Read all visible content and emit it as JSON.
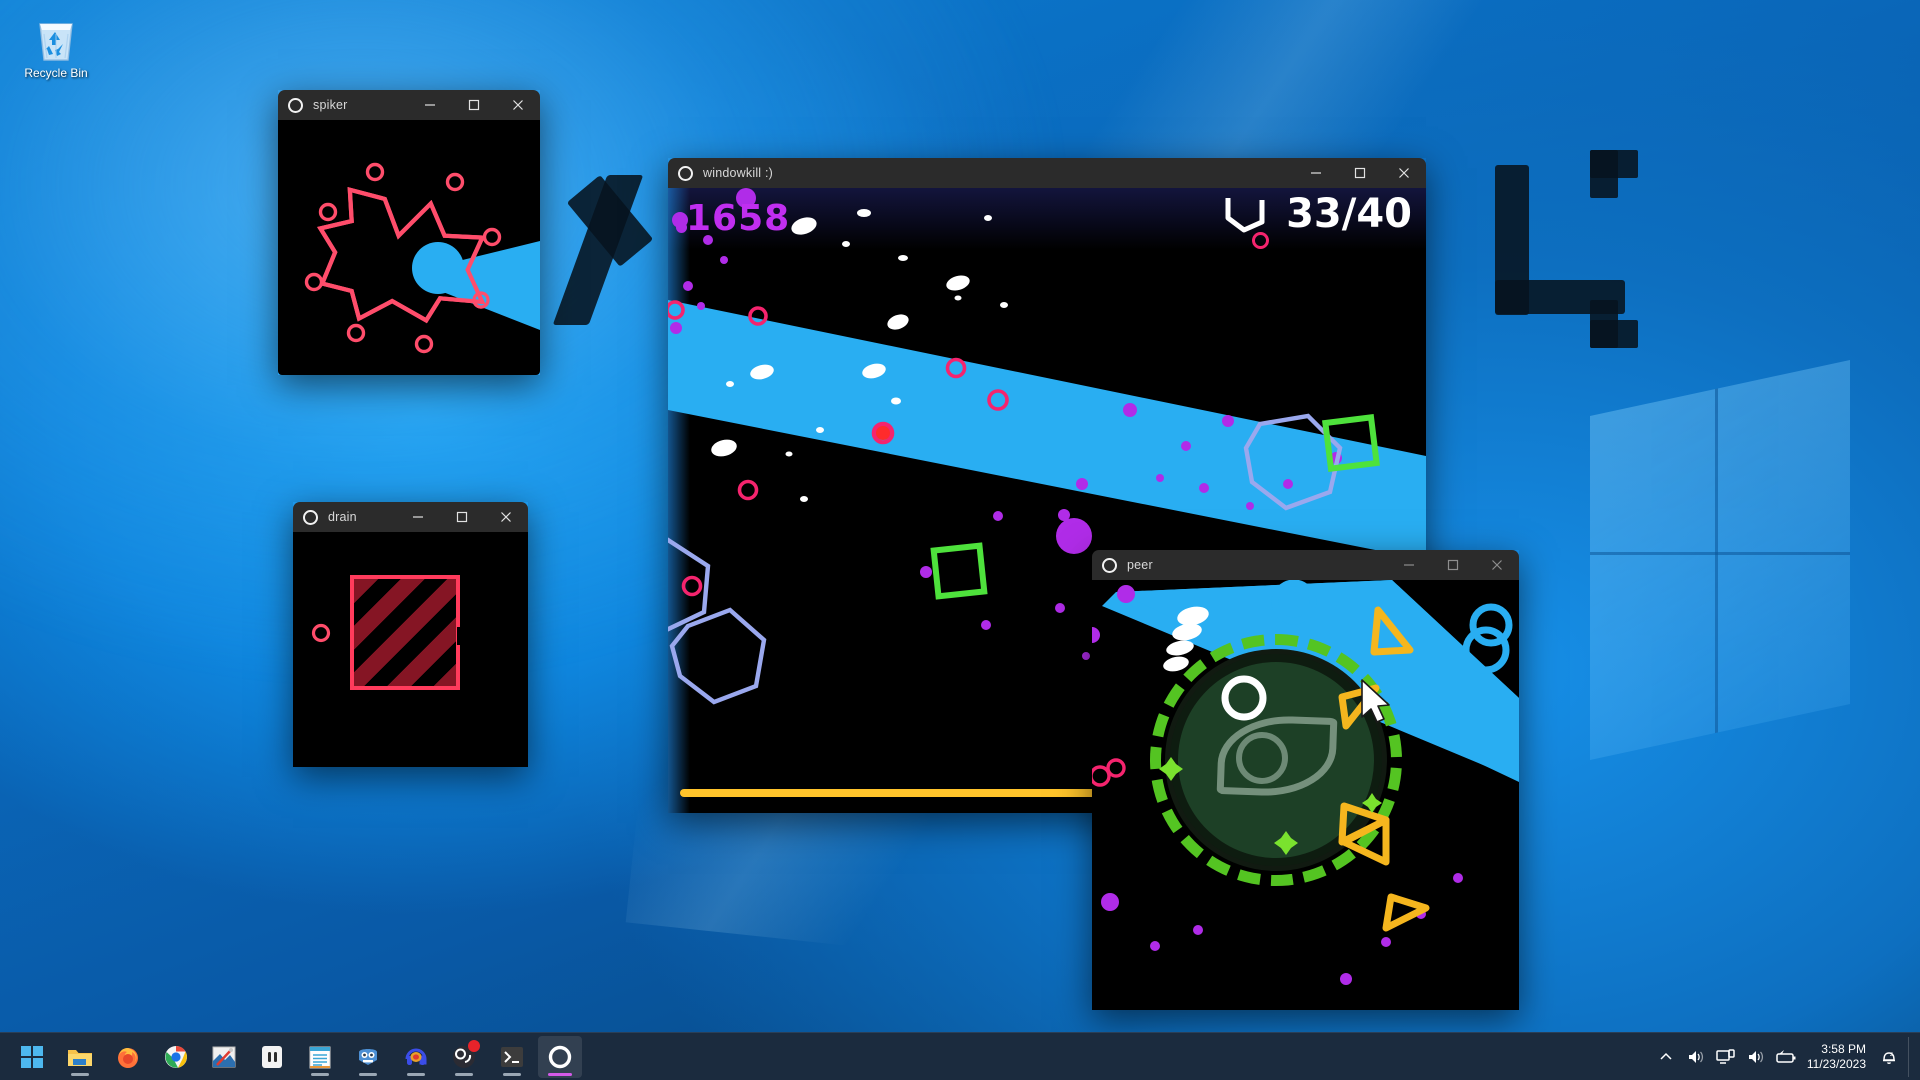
{
  "desktop": {
    "icons": [
      {
        "name": "recycle-bin",
        "label": "Recycle Bin"
      }
    ]
  },
  "windows": [
    {
      "id": "spiker",
      "title": "spiker",
      "controls": {
        "minimize": "—",
        "maximize": "□",
        "close": "✕"
      },
      "active": false
    },
    {
      "id": "drain",
      "title": "drain",
      "controls": {
        "minimize": "—",
        "maximize": "□",
        "close": "✕"
      },
      "active": true
    },
    {
      "id": "windowkill",
      "title": "windowkill :)",
      "controls": {
        "minimize": "—",
        "maximize": "□",
        "close": "✕"
      },
      "active": true
    },
    {
      "id": "peer",
      "title": "peer",
      "controls": {
        "minimize": "—",
        "maximize": "□",
        "close": "✕"
      },
      "active": false
    }
  ],
  "game": {
    "score": "1658",
    "hp_current": "33",
    "hp_max": "40",
    "hp_display": "33/40",
    "progress_percent": 92,
    "colors": {
      "score": "#c02ef0",
      "beam": "#29aef2",
      "enemy_ring": "#f5246e",
      "polygon": "#9aa8ee",
      "square": "#4ee23c",
      "triangle": "#f5b61e",
      "eye": "#1d4026",
      "dash_ring": "#54c422",
      "progress": "#ffc42b",
      "spiker_star": "#ff4d6b",
      "drain_box": "#ff3b5c"
    }
  },
  "taskbar": {
    "items": [
      {
        "name": "start-button",
        "label": "Start",
        "running": false,
        "active": false
      },
      {
        "name": "file-explorer",
        "label": "File Explorer",
        "running": true,
        "active": false
      },
      {
        "name": "firefox",
        "label": "Firefox",
        "running": false,
        "active": false
      },
      {
        "name": "google-chrome",
        "label": "Google Chrome",
        "running": false,
        "active": false
      },
      {
        "name": "image-editor",
        "label": "Paint",
        "running": false,
        "active": false
      },
      {
        "name": "app-window",
        "label": "App",
        "running": false,
        "active": false
      },
      {
        "name": "notepad",
        "label": "Notepad",
        "running": true,
        "active": false
      },
      {
        "name": "godot-engine",
        "label": "Godot Engine",
        "running": true,
        "active": false
      },
      {
        "name": "audio-app",
        "label": "Audio",
        "running": true,
        "active": false
      },
      {
        "name": "obs-studio",
        "label": "OBS Studio",
        "running": true,
        "active": false,
        "badge": true
      },
      {
        "name": "terminal",
        "label": "Terminal",
        "running": true,
        "active": false
      },
      {
        "name": "windowkill",
        "label": "windowkill",
        "running": true,
        "active": true
      }
    ],
    "tray": [
      {
        "name": "show-hidden-icons-icon",
        "glyph": "chevron-up"
      },
      {
        "name": "volume-icon",
        "glyph": "speaker"
      },
      {
        "name": "network-icon",
        "glyph": "monitor"
      },
      {
        "name": "volume-secondary-icon",
        "glyph": "speaker"
      },
      {
        "name": "battery-icon",
        "glyph": "battery"
      }
    ],
    "clock": {
      "time": "3:58 PM",
      "date": "11/23/2023"
    },
    "notifications": {
      "name": "do-not-disturb-icon",
      "state": "dnd"
    }
  }
}
